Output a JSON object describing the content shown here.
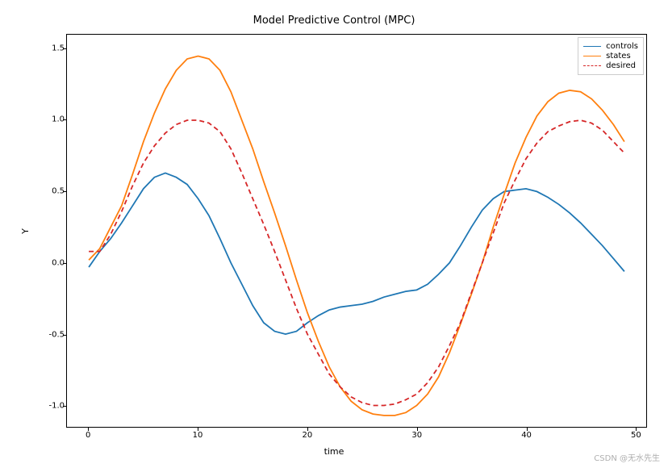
{
  "chart_data": {
    "type": "line",
    "title": "Model Predictive Control (MPC)",
    "xlabel": "time",
    "ylabel": "Y",
    "xlim": [
      -2,
      51
    ],
    "ylim": [
      -1.15,
      1.6
    ],
    "x_ticks": [
      0,
      10,
      20,
      30,
      40,
      50
    ],
    "y_ticks": [
      -1.0,
      -0.5,
      0.0,
      0.5,
      1.0,
      1.5
    ],
    "x": [
      0,
      1,
      2,
      3,
      4,
      5,
      6,
      7,
      8,
      9,
      10,
      11,
      12,
      13,
      14,
      15,
      16,
      17,
      18,
      19,
      20,
      21,
      22,
      23,
      24,
      25,
      26,
      27,
      28,
      29,
      30,
      31,
      32,
      33,
      34,
      35,
      36,
      37,
      38,
      39,
      40,
      41,
      42,
      43,
      44,
      45,
      46,
      47,
      48,
      49
    ],
    "series": [
      {
        "name": "controls",
        "color": "#1f77b4",
        "style": "solid",
        "values": [
          -0.03,
          0.08,
          0.17,
          0.28,
          0.4,
          0.52,
          0.6,
          0.63,
          0.6,
          0.55,
          0.45,
          0.33,
          0.17,
          0.0,
          -0.15,
          -0.3,
          -0.42,
          -0.48,
          -0.5,
          -0.48,
          -0.42,
          -0.37,
          -0.33,
          -0.31,
          -0.3,
          -0.29,
          -0.27,
          -0.24,
          -0.22,
          -0.2,
          -0.19,
          -0.15,
          -0.08,
          0.0,
          0.12,
          0.25,
          0.37,
          0.45,
          0.5,
          0.51,
          0.52,
          0.5,
          0.46,
          0.41,
          0.35,
          0.28,
          0.2,
          0.12,
          0.03,
          -0.06
        ]
      },
      {
        "name": "states",
        "color": "#ff7f0e",
        "style": "solid",
        "values": [
          0.02,
          0.1,
          0.25,
          0.4,
          0.62,
          0.85,
          1.05,
          1.22,
          1.35,
          1.43,
          1.45,
          1.43,
          1.35,
          1.2,
          1.0,
          0.8,
          0.57,
          0.35,
          0.12,
          -0.12,
          -0.35,
          -0.55,
          -0.73,
          -0.87,
          -0.97,
          -1.03,
          -1.06,
          -1.07,
          -1.07,
          -1.05,
          -1.0,
          -0.92,
          -0.8,
          -0.63,
          -0.43,
          -0.22,
          0.0,
          0.25,
          0.48,
          0.7,
          0.88,
          1.03,
          1.13,
          1.19,
          1.21,
          1.2,
          1.15,
          1.07,
          0.97,
          0.85
        ]
      },
      {
        "name": "desired",
        "color": "#d62728",
        "style": "dashed",
        "values": [
          0.08,
          0.08,
          0.2,
          0.36,
          0.54,
          0.7,
          0.82,
          0.91,
          0.97,
          1.0,
          1.0,
          0.98,
          0.92,
          0.8,
          0.63,
          0.45,
          0.27,
          0.08,
          -0.12,
          -0.32,
          -0.5,
          -0.64,
          -0.78,
          -0.87,
          -0.94,
          -0.98,
          -1.0,
          -1.0,
          -0.99,
          -0.96,
          -0.92,
          -0.84,
          -0.73,
          -0.58,
          -0.42,
          -0.21,
          0.0,
          0.21,
          0.42,
          0.58,
          0.73,
          0.84,
          0.92,
          0.96,
          0.99,
          1.0,
          0.98,
          0.93,
          0.85,
          0.77
        ]
      }
    ],
    "legend": {
      "position": "upper right",
      "entries": [
        "controls",
        "states",
        "desired"
      ]
    }
  },
  "watermark": "CSDN @无水先生"
}
